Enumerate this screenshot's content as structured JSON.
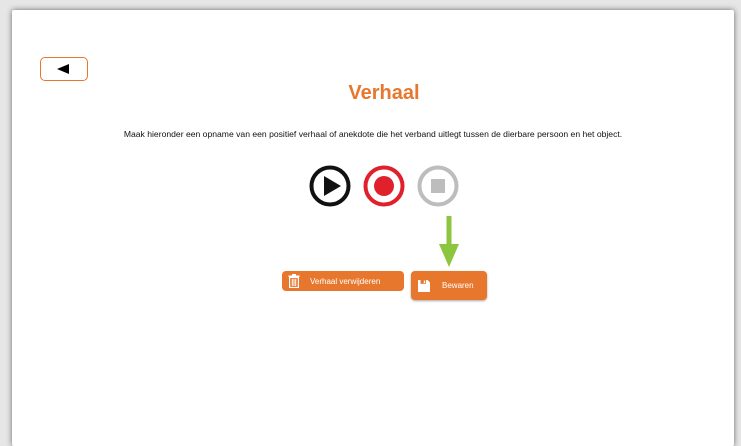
{
  "page": {
    "title": "Verhaal",
    "instruction": "Maak hieronder een opname van een positief verhaal of anekdote die het verband uitlegt tussen de dierbare persoon en het object."
  },
  "buttons": {
    "delete_label": "Verhaal verwijderen",
    "save_label": "Bewaren"
  },
  "icons": {
    "back": "back-arrow-icon",
    "play": "play-icon",
    "record": "record-icon",
    "stop": "stop-icon",
    "delete": "trash-icon",
    "save": "floppy-disk-icon",
    "hint": "down-arrow-icon"
  },
  "colors": {
    "accent": "#e8772e",
    "record": "#e0212c",
    "stop_disabled": "#bdbdbd",
    "hint_arrow": "#8cc63f"
  }
}
